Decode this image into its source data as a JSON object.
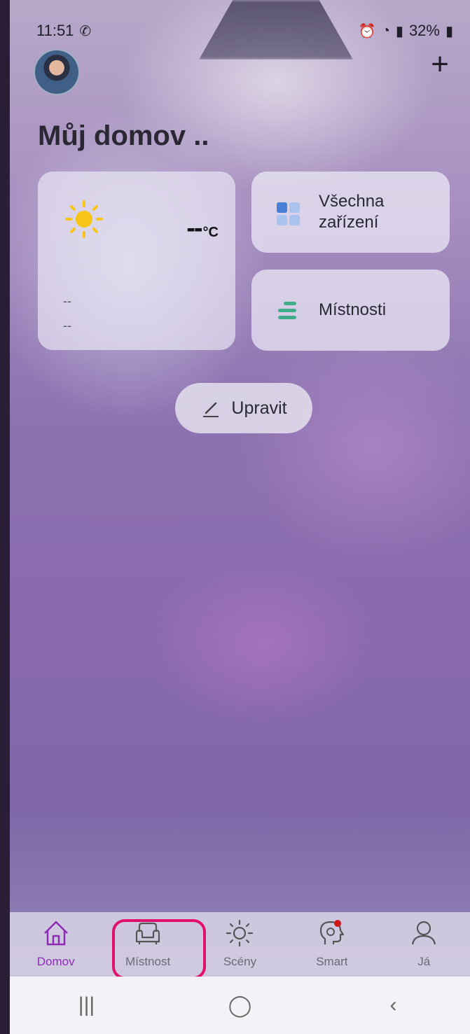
{
  "status_bar": {
    "time": "11:51",
    "battery": "32%",
    "icons": [
      "whatsapp-icon",
      "alarm-icon",
      "wifi-icon",
      "signal-icon",
      "battery-icon"
    ]
  },
  "header": {
    "add_symbol": "+"
  },
  "page_title": "Můj domov ..",
  "weather": {
    "temperature": "--",
    "unit": "°C",
    "line1": "--",
    "line2": "--",
    "icon": "sun-icon"
  },
  "tiles": {
    "all_devices": "Všechna zařízení",
    "rooms": "Místnosti"
  },
  "edit_button": "Upravit",
  "tabs": [
    {
      "label": "Domov",
      "icon": "home-icon",
      "active": true
    },
    {
      "label": "Místnost",
      "icon": "armchair-icon",
      "active": false
    },
    {
      "label": "Scény",
      "icon": "sun-icon",
      "active": false
    },
    {
      "label": "Smart",
      "icon": "brain-icon",
      "active": false
    },
    {
      "label": "Já",
      "icon": "person-icon",
      "active": false
    }
  ],
  "nav": {
    "recents": "|||",
    "home": "◯",
    "back": "‹"
  },
  "colors": {
    "active_tab": "#8e2bb5",
    "highlight": "#e0106f",
    "rooms_icon": "#3fae88",
    "devices_icon": "#4a7fd8"
  }
}
